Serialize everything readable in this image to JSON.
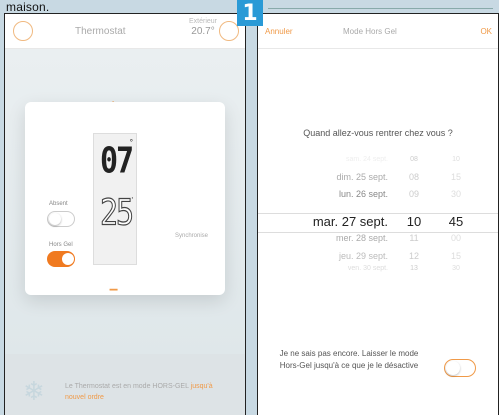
{
  "caption": {
    "top_fragment": "maison.",
    "step_number": "1"
  },
  "left_screen": {
    "title": "Thermostat",
    "exterior_label": "Extérieur",
    "exterior_value": "20.7°",
    "setpoint": "07",
    "temperature": "25",
    "absent_label": "Absent",
    "hors_gel_label": "Hors Gel",
    "absent_on": false,
    "hors_gel_on": true,
    "sync_label": "Synchronise",
    "plus": "+",
    "minus": "−",
    "footer_text": "Le Thermostat est en mode HORS-GEL",
    "footer_highlight": "jusqu'à nouvel ordre"
  },
  "right_screen": {
    "cancel": "Annuler",
    "title": "Mode Hors Gel",
    "ok": "OK",
    "question": "Quand allez-vous rentrer chez vous ?",
    "picker": {
      "rows": [
        {
          "day": "sam. 24 sept.",
          "hour": "08",
          "min": "10"
        },
        {
          "day": "dim. 25 sept.",
          "hour": "08",
          "min": "15"
        },
        {
          "day": "lun. 26 sept.",
          "hour": "09",
          "min": "30"
        },
        {
          "day": "mar. 27 sept.",
          "hour": "10",
          "min": "45"
        },
        {
          "day": "mer. 28 sept.",
          "hour": "11",
          "min": "00"
        },
        {
          "day": "jeu. 29 sept.",
          "hour": "12",
          "min": "15"
        },
        {
          "day": "ven. 30 sept.",
          "hour": "13",
          "min": "30"
        }
      ]
    },
    "undecided_text": "Je ne sais pas encore. Laisser le mode Hors-Gel jusqu'à ce que je le désactive",
    "undecided_on": false
  }
}
